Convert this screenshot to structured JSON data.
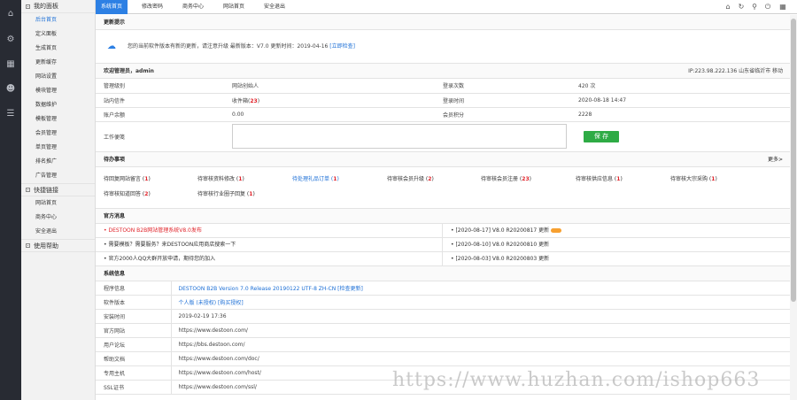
{
  "iconbar": [
    "home-icon",
    "gear-icon",
    "grid-icon",
    "user-icon",
    "signal-icon"
  ],
  "sidebar": {
    "group1": "我的面板",
    "items1": [
      "后台首页",
      "定义面板",
      "生成首页",
      "更新缓存",
      "网站设置",
      "模块管理",
      "数据维护",
      "模板管理",
      "会员管理",
      "单页管理",
      "排名推广",
      "广告管理"
    ],
    "group2": "快捷链接",
    "items2": [
      "网站首页",
      "商务中心",
      "安全退出"
    ],
    "group3": "使用帮助"
  },
  "topbar": {
    "tabs": [
      "系统首页",
      "修改密码",
      "商务中心",
      "网站首页",
      "安全退出"
    ]
  },
  "update": {
    "title": "更新提示",
    "text": "您的当前软件版本有新的更新，请注意升级  最新版本：V7.0  更新时间：2019-04-16",
    "link": "[立即检查]"
  },
  "welcome": {
    "title": "欢迎管理员，admin",
    "ip": "IP:223.98.222.136 山东省临沂市 移动",
    "rows": [
      [
        "管理级别",
        "网站创始人",
        "登录次数",
        "420 次"
      ],
      [
        "站内信件",
        "收件箱",
        "23",
        "登录时间",
        "2020-08-18 14:47"
      ],
      [
        "账户余额",
        "0.00",
        "会员积分",
        "2228"
      ]
    ],
    "memo_label": "工作便笺",
    "save_label": "保 存"
  },
  "todo": {
    "title": "待办事项",
    "more": "更多>",
    "items": [
      {
        "label": "待回复网站留言",
        "count": "1"
      },
      {
        "label": "待审核资料修改",
        "count": "1"
      },
      {
        "label": "待处理礼品订单",
        "count": "1"
      },
      {
        "label": "待审核会员升级",
        "count": "2"
      },
      {
        "label": "待审核会员注册",
        "count": "23"
      },
      {
        "label": "待审核供应信息",
        "count": "1"
      },
      {
        "label": "待审核大宗采购",
        "count": "1"
      },
      {
        "label": "待审核知道回答",
        "count": "2"
      },
      {
        "label": "待审核行业圈子回复",
        "count": "1"
      }
    ]
  },
  "news": {
    "title": "官方消息",
    "left": [
      "• DESTOON B2B网站管理系统V8.0发布",
      "• 需要模板？需要服务？来DESTOON应用商店搜索一下",
      "• 官方2000人QQ大群开放申请，期待您的加入"
    ],
    "right": [
      "• [2020-08-17]  V8.0 R20200817 更新",
      "• [2020-08-10]  V8.0 R20200810 更新",
      "• [2020-08-03]  V8.0 R20200803 更新"
    ]
  },
  "sysinfo": {
    "title": "系统信息",
    "rows": [
      [
        "程序信息",
        "DESTOON B2B Version 7.0 Release 20190122 UTF-8 ZH-CN [检查更新]"
      ],
      [
        "软件版本",
        "个人版 (未授权)  [购买授权]"
      ],
      [
        "安装时间",
        "2019-02-19 17:36"
      ],
      [
        "官方网站",
        "https://www.destoon.com/"
      ],
      [
        "用户论坛",
        "https://bbs.destoon.com/"
      ],
      [
        "帮助文档",
        "https://www.destoon.com/doc/"
      ],
      [
        "专用主机",
        "https://www.destoon.com/host/"
      ],
      [
        "SSL证书",
        "https://www.destoon.com/ssl/"
      ]
    ]
  },
  "watermark": "https://www.huzhan.com/ishop663"
}
